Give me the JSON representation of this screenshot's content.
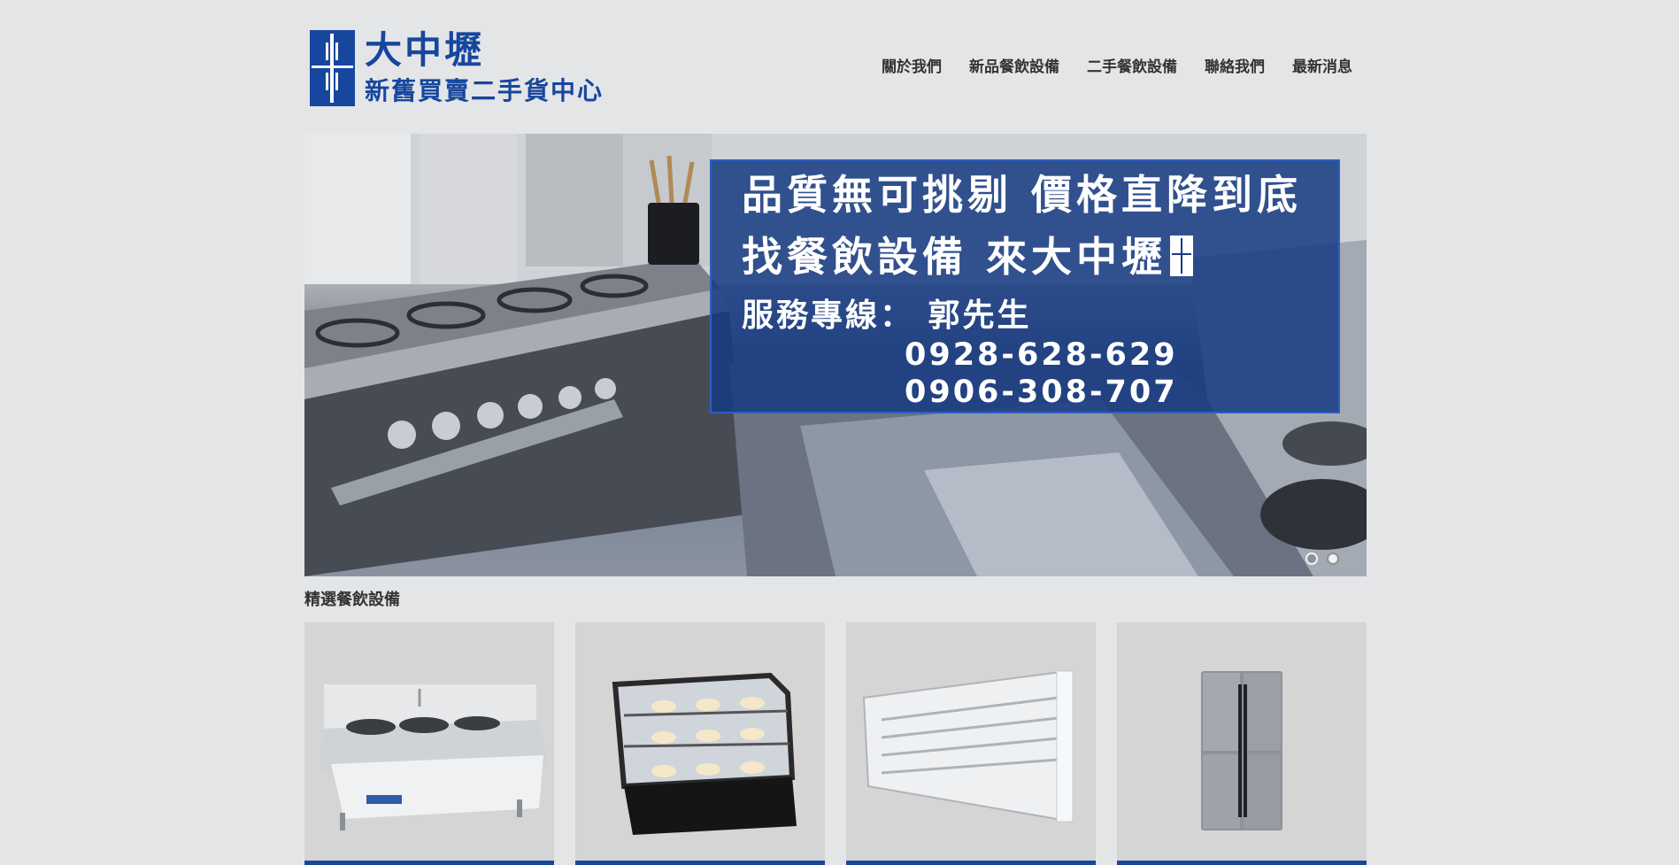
{
  "brand": {
    "title": "大中壢",
    "subtitle": "新舊買賣二手貨中心",
    "color": "#17469e",
    "icon": "refrigerator-logo-icon"
  },
  "nav": {
    "items": [
      {
        "label": "關於我們"
      },
      {
        "label": "新品餐飲設備"
      },
      {
        "label": "二手餐飲設備"
      },
      {
        "label": "聯絡我們"
      },
      {
        "label": "最新消息"
      }
    ]
  },
  "hero": {
    "line1": "品質無可挑剔  價格直降到底",
    "line2": "找餐飲設備  來大中壢",
    "line3": "服務專線：  郭先生",
    "phone1": "0928-628-629",
    "phone2": "0906-308-707",
    "overlay_color": "#163a82",
    "slides_total": 2,
    "slide_active": 1
  },
  "featured": {
    "title": "精選餐飲設備",
    "items": [
      {
        "icon": "commercial-stove-icon"
      },
      {
        "icon": "cake-display-case-icon"
      },
      {
        "icon": "open-refrigerated-showcase-icon"
      },
      {
        "icon": "french-door-refrigerator-icon"
      }
    ]
  }
}
